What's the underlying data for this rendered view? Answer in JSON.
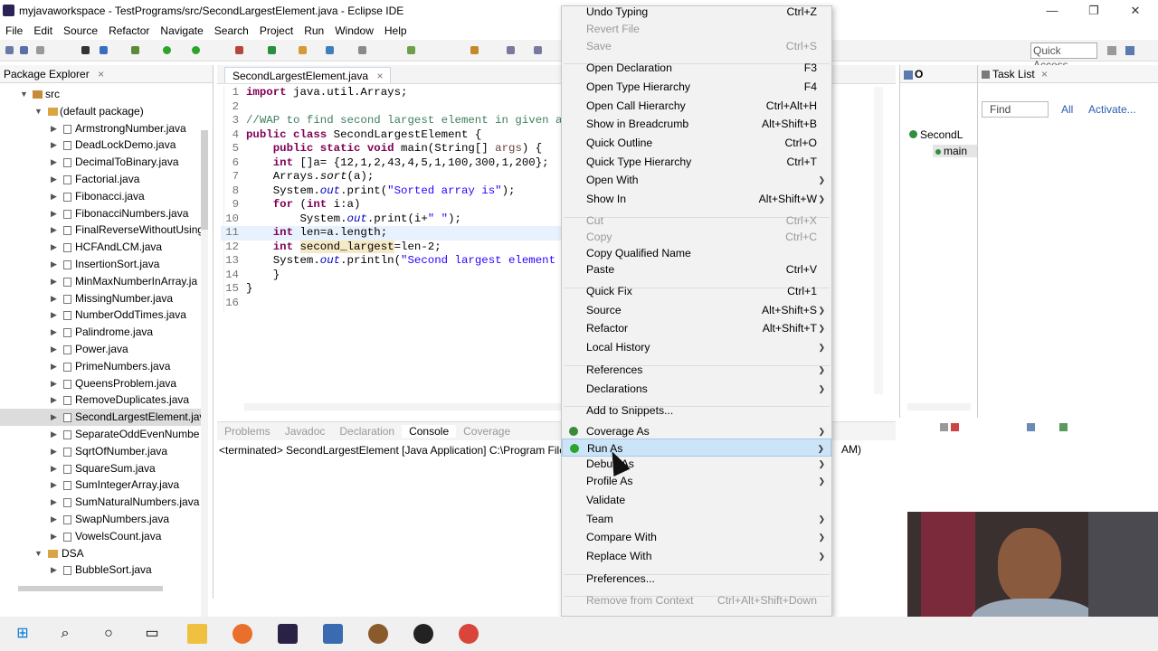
{
  "window": {
    "title": "myjavaworkspace - TestPrograms/src/SecondLargestElement.java - Eclipse IDE",
    "minimize_label": "—",
    "maximize_label": "❐",
    "close_label": "✕"
  },
  "menubar": [
    "File",
    "Edit",
    "Source",
    "Refactor",
    "Navigate",
    "Search",
    "Project",
    "Run",
    "Window",
    "Help"
  ],
  "toolbar": {
    "quick_access": "Quick Access"
  },
  "package_explorer": {
    "title": "Package Explorer",
    "src": "src",
    "default_package": "(default package)",
    "files": [
      "ArmstrongNumber.java",
      "DeadLockDemo.java",
      "DecimalToBinary.java",
      "Factorial.java",
      "Fibonacci.java",
      "FibonacciNumbers.java",
      "FinalReverseWithoutUsing",
      "HCFAndLCM.java",
      "InsertionSort.java",
      "MinMaxNumberInArray.ja",
      "MissingNumber.java",
      "NumberOddTimes.java",
      "Palindrome.java",
      "Power.java",
      "PrimeNumbers.java",
      "QueensProblem.java",
      "RemoveDuplicates.java",
      "SecondLargestElement.jav",
      "SeparateOddEvenNumbe",
      "SqrtOfNumber.java",
      "SquareSum.java",
      "SumIntegerArray.java",
      "SumNaturalNumbers.java",
      "SwapNumbers.java",
      "VowelsCount.java"
    ],
    "dsa_folder": "DSA",
    "dsa_files": [
      "BubbleSort.java"
    ]
  },
  "editor": {
    "tab": "SecondLargestElement.java",
    "lines": [
      {
        "n": "1",
        "text": "import java.util.Arrays;"
      },
      {
        "n": "2",
        "text": ""
      },
      {
        "n": "3",
        "text": "//WAP to find second largest element in given ar"
      },
      {
        "n": "4",
        "text": "public class SecondLargestElement {"
      },
      {
        "n": "5",
        "text": "    public static void main(String[] args) {"
      },
      {
        "n": "6",
        "text": "    int []a= {12,1,2,43,4,5,1,100,300,1,200};"
      },
      {
        "n": "7",
        "text": "    Arrays.sort(a);"
      },
      {
        "n": "8",
        "text": "    System.out.print(\"Sorted array is\");"
      },
      {
        "n": "9",
        "text": "    for (int i:a)"
      },
      {
        "n": "10",
        "text": "        System.out.print(i+\" \");"
      },
      {
        "n": "11",
        "text": "    int len=a.length;"
      },
      {
        "n": "12",
        "text": "    int second_largest=len-2;"
      },
      {
        "n": "13",
        "text": "    System.out.println(\"Second largest element i"
      },
      {
        "n": "14",
        "text": "    }"
      },
      {
        "n": "15",
        "text": "}"
      },
      {
        "n": "16",
        "text": ""
      }
    ]
  },
  "console": {
    "tabs": [
      "Problems",
      "Javadoc",
      "Declaration",
      "Console",
      "Coverage"
    ],
    "active_tab": "Console",
    "status": "<terminated> SecondLargestElement [Java Application] C:\\Program Files",
    "status_tail": "AM)"
  },
  "outline": {
    "tab": "O",
    "class_label": "SecondL",
    "method_label": "main"
  },
  "task_list": {
    "title": "Task List",
    "find_placeholder": "Find",
    "all": "All",
    "activate": "Activate..."
  },
  "context_menu": {
    "items": [
      {
        "label": "Undo Typing",
        "shortcut": "Ctrl+Z",
        "disabled": false
      },
      {
        "label": "Revert File",
        "shortcut": "",
        "disabled": true
      },
      {
        "label": "Save",
        "shortcut": "Ctrl+S",
        "disabled": true
      },
      {
        "label": "Open Declaration",
        "shortcut": "F3",
        "disabled": false
      },
      {
        "label": "Open Type Hierarchy",
        "shortcut": "F4",
        "disabled": false
      },
      {
        "label": "Open Call Hierarchy",
        "shortcut": "Ctrl+Alt+H",
        "disabled": false
      },
      {
        "label": "Show in Breadcrumb",
        "shortcut": "Alt+Shift+B",
        "disabled": false
      },
      {
        "label": "Quick Outline",
        "shortcut": "Ctrl+O",
        "disabled": false
      },
      {
        "label": "Quick Type Hierarchy",
        "shortcut": "Ctrl+T",
        "disabled": false
      },
      {
        "label": "Open With",
        "shortcut": "",
        "disabled": false
      },
      {
        "label": "Show In",
        "shortcut": "Alt+Shift+W",
        "disabled": false
      },
      {
        "label": "Cut",
        "shortcut": "Ctrl+X",
        "disabled": true
      },
      {
        "label": "Copy",
        "shortcut": "Ctrl+C",
        "disabled": true
      },
      {
        "label": "Copy Qualified Name",
        "shortcut": "",
        "disabled": false
      },
      {
        "label": "Paste",
        "shortcut": "Ctrl+V",
        "disabled": false
      },
      {
        "label": "Quick Fix",
        "shortcut": "Ctrl+1",
        "disabled": false
      },
      {
        "label": "Source",
        "shortcut": "Alt+Shift+S",
        "disabled": false
      },
      {
        "label": "Refactor",
        "shortcut": "Alt+Shift+T",
        "disabled": false
      },
      {
        "label": "Local History",
        "shortcut": "",
        "disabled": false
      },
      {
        "label": "References",
        "shortcut": "",
        "disabled": false
      },
      {
        "label": "Declarations",
        "shortcut": "",
        "disabled": false
      },
      {
        "label": "Add to Snippets...",
        "shortcut": "",
        "disabled": false
      },
      {
        "label": "Coverage As",
        "shortcut": "",
        "disabled": false
      },
      {
        "label": "Run As",
        "shortcut": "",
        "disabled": false
      },
      {
        "label": "Debug As",
        "shortcut": "",
        "disabled": false
      },
      {
        "label": "Profile As",
        "shortcut": "",
        "disabled": false
      },
      {
        "label": "Validate",
        "shortcut": "",
        "disabled": false
      },
      {
        "label": "Team",
        "shortcut": "",
        "disabled": false
      },
      {
        "label": "Compare With",
        "shortcut": "",
        "disabled": false
      },
      {
        "label": "Replace With",
        "shortcut": "",
        "disabled": false
      },
      {
        "label": "Preferences...",
        "shortcut": "",
        "disabled": false
      },
      {
        "label": "Remove from Context",
        "shortcut": "Ctrl+Alt+Shift+Down",
        "disabled": true
      }
    ],
    "submenu_arrow": "❯"
  },
  "colors": {
    "menu_highlight": "#cce4f7",
    "keyword": "#7f0055",
    "string": "#2a00ff",
    "comment": "#3f7f5f"
  }
}
